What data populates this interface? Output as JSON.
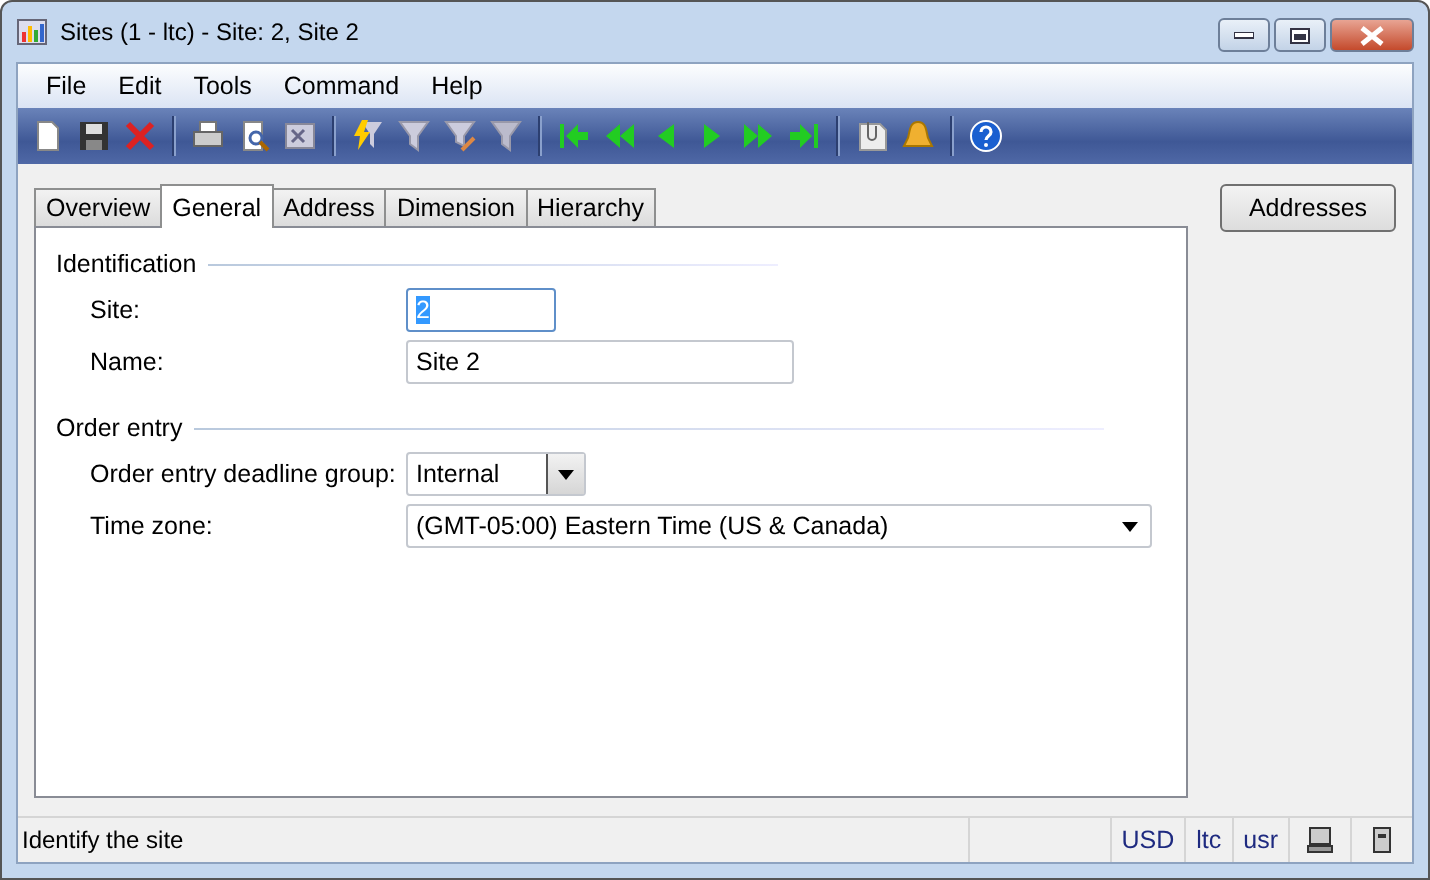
{
  "window": {
    "title": "Sites (1 - ltc) - Site: 2, Site 2"
  },
  "menu": [
    "File",
    "Edit",
    "Tools",
    "Command",
    "Help"
  ],
  "tabs": [
    {
      "label": "Overview",
      "selected": false
    },
    {
      "label": "General",
      "selected": true
    },
    {
      "label": "Address",
      "selected": false
    },
    {
      "label": "Dimension",
      "selected": false
    },
    {
      "label": "Hierarchy",
      "selected": false
    }
  ],
  "groups": [
    {
      "title": "Identification",
      "fields": [
        {
          "label": "Site:",
          "kind": "text",
          "value": "2",
          "focused": true
        },
        {
          "label": "Name:",
          "kind": "text",
          "value": "Site 2",
          "focused": false
        }
      ]
    },
    {
      "title": "Order entry",
      "fields": [
        {
          "label": "Order entry deadline group:",
          "kind": "lookup",
          "value": "Internal",
          "focused": false
        },
        {
          "label": "Time zone:",
          "kind": "combo",
          "value": "(GMT-05:00) Eastern Time (US & Canada)",
          "focused": false
        }
      ]
    }
  ],
  "side_buttons": [
    "Addresses"
  ],
  "status_bar": {
    "message": "Identify the site",
    "cells": [
      "USD",
      "ltc",
      "usr"
    ]
  }
}
